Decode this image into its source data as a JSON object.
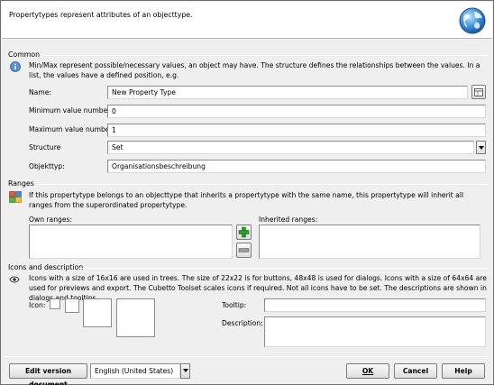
{
  "banner": {
    "text": "Propertytypes represent attributes of an objecttype."
  },
  "common": {
    "title": "Common",
    "info": "Min/Max represent possible/necessary values, an object may have. The structure defines the relationships between the values. In a list, the values have a defined position, e.g.",
    "name_label": "Name:",
    "name_value": "New Property Type",
    "min_label": "Minimum value number:",
    "min_value": "0",
    "max_label": "Maximum value number:",
    "max_value": "1",
    "structure_label": "Structure",
    "structure_value": "Set",
    "objecttype_label": "Objekttyp:",
    "objecttype_value": "Organisationsbeschreibung"
  },
  "ranges": {
    "title": "Ranges",
    "info": "If this propertytype belongs to an objecttype that inherits a propertytype with the same name, this propertytype will inherit all ranges from the superordinated propertytype.",
    "own_label": "Own ranges:",
    "inherited_label": "Inherited ranges:"
  },
  "icons": {
    "title": "Icons and description",
    "info": "Icons with a size of 16x16 are used in trees. The size of 22x22 is for buttons, 48x48 is used for dialogs. Icons with a size of 64x64 are used for previews and export. The Cubetto Toolset scales icons if required. Not all icons have to be set. The descriptions are shown in dialogs and tooltips.",
    "icon_label": "Icon:",
    "tooltip_label": "Tooltip:",
    "description_label": "Description:"
  },
  "footer": {
    "edit_version": "Edit version document",
    "language": "English (United States)",
    "ok": "OK",
    "cancel": "Cancel",
    "help": "Help"
  },
  "colors": {
    "add_green": "#2f9e2f",
    "remove_gray": "#9a9a9a",
    "globe_blue": "#2f7fc9"
  }
}
